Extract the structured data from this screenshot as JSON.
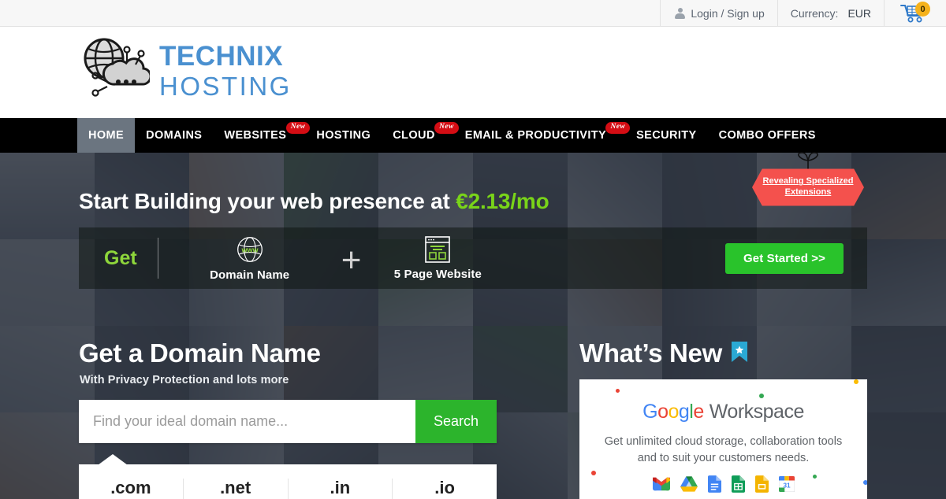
{
  "topbar": {
    "login_label": "Login / Sign up",
    "currency_label": "Currency:",
    "currency_value": "EUR",
    "cart_count": "0"
  },
  "logo": {
    "line1": "TECHNIX",
    "line2": "HOSTING",
    "color": "#4a90d0"
  },
  "nav": {
    "items": [
      {
        "label": "HOME",
        "badge": "",
        "active": true
      },
      {
        "label": "DOMAINS",
        "badge": "",
        "active": false
      },
      {
        "label": "WEBSITES",
        "badge": "New",
        "active": false
      },
      {
        "label": "HOSTING",
        "badge": "",
        "active": false
      },
      {
        "label": "CLOUD",
        "badge": "New",
        "active": false
      },
      {
        "label": "EMAIL & PRODUCTIVITY",
        "badge": "New",
        "active": false
      },
      {
        "label": "SECURITY",
        "badge": "",
        "active": false
      },
      {
        "label": "COMBO OFFERS",
        "badge": "",
        "active": false
      }
    ],
    "badge_color": "#d40d14",
    "active_bg": "#6b7580"
  },
  "hero": {
    "headline_prefix": "Start Building your web presence at ",
    "headline_price": "€2.13/mo",
    "price_color": "#79d419",
    "promo": {
      "get_label": "Get",
      "domain_label": "Domain Name",
      "domain_icon_text": "www",
      "plus": "+",
      "website_label": "5 Page Website",
      "cta_label": "Get Started >>",
      "cta_color": "#29c32b"
    },
    "badge": {
      "line1": "Revealing Specialized",
      "line2": "Extensions",
      "color": "#f4514d"
    }
  },
  "domain_section": {
    "title": "Get a Domain Name",
    "subtitle": "With Privacy Protection and lots more",
    "search_placeholder": "Find your ideal domain name...",
    "search_value": "",
    "search_button": "Search",
    "tlds": [
      ".com",
      ".net",
      ".in",
      ".io"
    ]
  },
  "whats_new": {
    "title": "What’s New",
    "ribbon_color": "#2aa9d4",
    "card": {
      "brand_google": "Google",
      "brand_workspace": "Workspace",
      "description": "Get unlimited cloud storage, collaboration tools and to suit your customers needs.",
      "apps": [
        "gmail-icon",
        "drive-icon",
        "docs-icon",
        "sheets-icon",
        "slides-icon",
        "calendar-icon"
      ]
    }
  }
}
